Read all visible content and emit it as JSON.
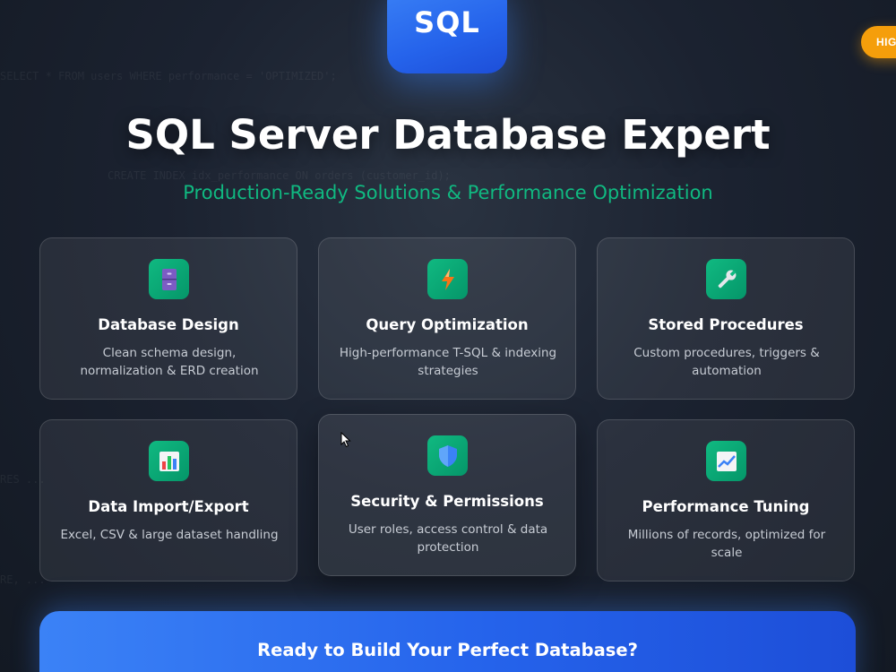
{
  "background_code": [
    "SELECT * FROM users WHERE performance = 'OPTIMIZED';",
    "CREATE INDEX idx_performance ON orders (customer_id);",
    "RES ...",
    "RE, ..."
  ],
  "logo": {
    "text": "SQL",
    "color": "#2563eb"
  },
  "badge": {
    "text": "HIGHLY",
    "color": "#f59e0b"
  },
  "hero": {
    "title": "SQL Server Database Expert",
    "subtitle": "Production-Ready Solutions & Performance Optimization",
    "subtitle_color": "#10b981"
  },
  "services": [
    {
      "icon": "file-cabinet-icon",
      "title": "Database Design",
      "description": "Clean schema design, normalization & ERD creation"
    },
    {
      "icon": "lightning-icon",
      "title": "Query Optimization",
      "description": "High-performance T-SQL & indexing strategies"
    },
    {
      "icon": "wrench-icon",
      "title": "Stored Procedures",
      "description": "Custom procedures, triggers & automation"
    },
    {
      "icon": "bar-chart-icon",
      "title": "Data Import/Export",
      "description": "Excel, CSV & large dataset handling"
    },
    {
      "icon": "shield-icon",
      "title": "Security & Permissions",
      "description": "User roles, access control & data protection"
    },
    {
      "icon": "trending-chart-icon",
      "title": "Performance Tuning",
      "description": "Millions of records, optimized for scale"
    }
  ],
  "cta": {
    "title": "Ready to Build Your Perfect Database?"
  },
  "colors": {
    "accent": "#10b981",
    "brand": "#2563eb",
    "background": "#1b2230"
  }
}
